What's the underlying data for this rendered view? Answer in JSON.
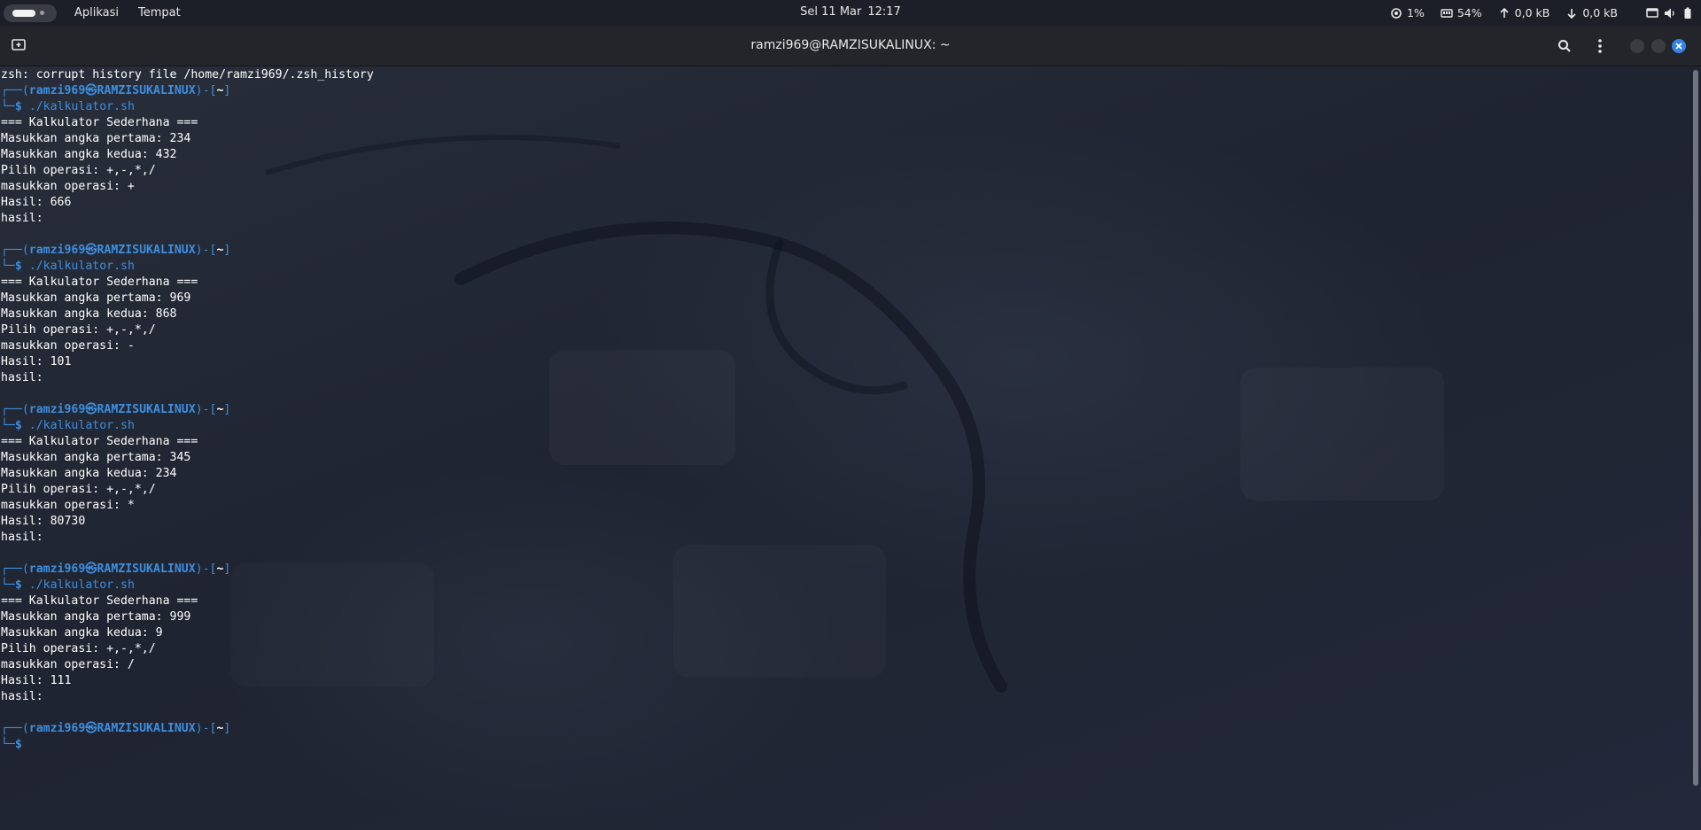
{
  "topbar": {
    "menus": [
      "Aplikasi",
      "Tempat"
    ],
    "clock_day": "Sel 11 Mar",
    "clock_time": "12:17",
    "cpu": "1%",
    "memory": "54%",
    "upload": "0,0 kB",
    "download": "0,0 kB",
    "icons": [
      "activities-icon",
      "cpu-icon",
      "memory-icon",
      "upload-arrow-icon",
      "download-arrow-icon",
      "screen-icon",
      "volume-icon",
      "battery-icon"
    ]
  },
  "window": {
    "title": "ramzi969@RAMZISUKALINUX: ~",
    "icons": [
      "new-tab-icon",
      "search-icon",
      "menu-kebab-icon",
      "minimize-icon",
      "maximize-icon",
      "close-icon"
    ]
  },
  "prompt": {
    "box_top": "┌──(",
    "user": "ramzi969",
    "at": "㉿",
    "host": "RAMZISUKALINUX",
    "path_open": ")-[",
    "path": "~",
    "path_close": "]",
    "box_bottom": "└─",
    "dollar": "$"
  },
  "terminal": {
    "first_line": "zsh: corrupt history file /home/ramzi969/.zsh_history",
    "sessions": [
      {
        "command": "./kalkulator.sh",
        "output": [
          "=== Kalkulator Sederhana ===",
          "Masukkan angka pertama: 234",
          "Masukkan angka kedua: 432",
          "Pilih operasi: +,-,*,/",
          "masukkan operasi: +",
          "Hasil: 666",
          "hasil:",
          ""
        ]
      },
      {
        "command": "./kalkulator.sh",
        "output": [
          "=== Kalkulator Sederhana ===",
          "Masukkan angka pertama: 969",
          "Masukkan angka kedua: 868",
          "Pilih operasi: +,-,*,/",
          "masukkan operasi: -",
          "Hasil: 101",
          "hasil:",
          ""
        ]
      },
      {
        "command": "./kalkulator.sh",
        "output": [
          "=== Kalkulator Sederhana ===",
          "Masukkan angka pertama: 345",
          "Masukkan angka kedua: 234",
          "Pilih operasi: +,-,*,/",
          "masukkan operasi: *",
          "Hasil: 80730",
          "hasil:",
          ""
        ]
      },
      {
        "command": "./kalkulator.sh",
        "output": [
          "=== Kalkulator Sederhana ===",
          "Masukkan angka pertama: 999",
          "Masukkan angka kedua: 9",
          "Pilih operasi: +,-,*,/",
          "masukkan operasi: /",
          "Hasil: 111",
          "hasil:",
          ""
        ]
      },
      {
        "command": "",
        "output": []
      }
    ]
  },
  "colors": {
    "prompt_blue": "#3d8fe0",
    "close_button": "#3584e4",
    "terminal_text": "#ffffff",
    "titlebar_bg": "#23252b",
    "topbar_bg": "#1c1f27"
  }
}
